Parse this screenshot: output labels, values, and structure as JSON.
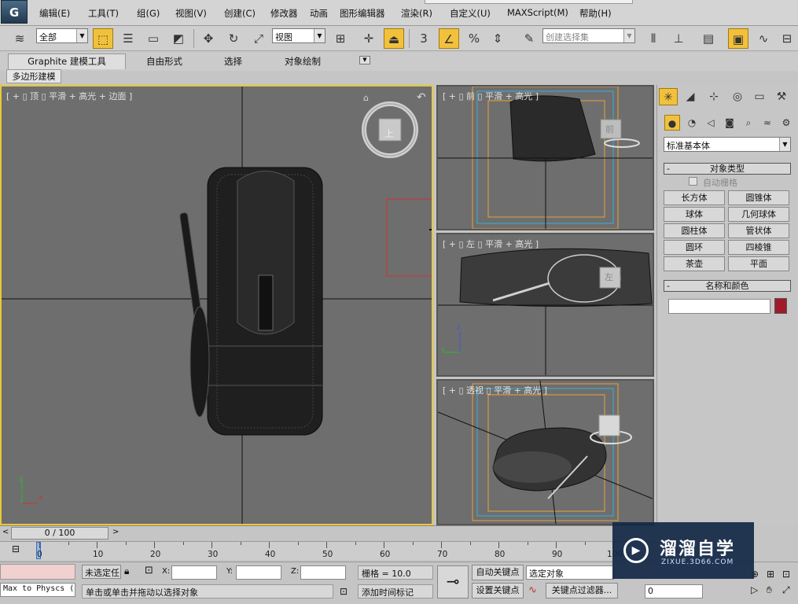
{
  "menubar": {
    "logo": "G",
    "items": [
      "编辑(E)",
      "工具(T)",
      "组(G)",
      "视图(V)",
      "创建(C)",
      "修改器",
      "动画",
      "图形编辑器",
      "渲染(R)",
      "自定义(U)",
      "MAXScript(M)",
      "帮助(H)"
    ]
  },
  "toolbar": {
    "selection_filter": "全部",
    "reference_coord": "视图",
    "snap_value": "3",
    "named_selection_placeholder": "创建选择集"
  },
  "ribbon": {
    "tabs": [
      "Graphite 建模工具",
      "自由形式",
      "选择",
      "对象绘制"
    ],
    "sub_tab": "多边形建模"
  },
  "viewports": {
    "top": {
      "label": "[ + ▯ 顶 ▯ 平滑 + 高光 + 边面 ]",
      "viewcube": "上",
      "axis_x": "x",
      "axis_y": "y"
    },
    "front": {
      "label": "[ + ▯ 前 ▯ 平滑 + 高光 ]",
      "viewcube": "前"
    },
    "left": {
      "label": "[ + ▯ 左 ▯ 平滑 + 高光 ]",
      "viewcube": "左",
      "axis_z": "z",
      "axis_y": "y"
    },
    "perspective": {
      "label": "[ + ▯ 透视 ▯ 平滑 + 高光 ]"
    }
  },
  "command_panel": {
    "category": "标准基本体",
    "object_type_title": "对象类型",
    "autogrid": "自动栅格",
    "objects": [
      "长方体",
      "圆锥体",
      "球体",
      "几何球体",
      "圆柱体",
      "管状体",
      "圆环",
      "四棱锥",
      "茶壶",
      "平面"
    ],
    "name_color_title": "名称和颜色",
    "object_color": "#a01a2a"
  },
  "timeline": {
    "frame": "0 / 100",
    "ticks": [
      "0",
      "10",
      "20",
      "30",
      "40",
      "50",
      "60",
      "70",
      "80",
      "90",
      "100"
    ]
  },
  "status": {
    "maxscript": "Max to Physcs (",
    "selection": "未选定任",
    "x_label": "X:",
    "y_label": "Y:",
    "z_label": "Z:",
    "grid": "栅格 = 10.0",
    "autokey": "自动关键点",
    "selected_object": "选定对象",
    "set_key": "设置关键点",
    "key_filters": "关键点过滤器...",
    "prompt": "单击或单击并拖动以选择对象",
    "add_time_tag": "添加时间标记",
    "frame_field": "0"
  },
  "watermark": {
    "title": "溜溜自学",
    "url": "ZIXUE.3D66.COM"
  },
  "colors": {
    "active_border": "#e8c83a",
    "highlight": "#f2c13c"
  }
}
